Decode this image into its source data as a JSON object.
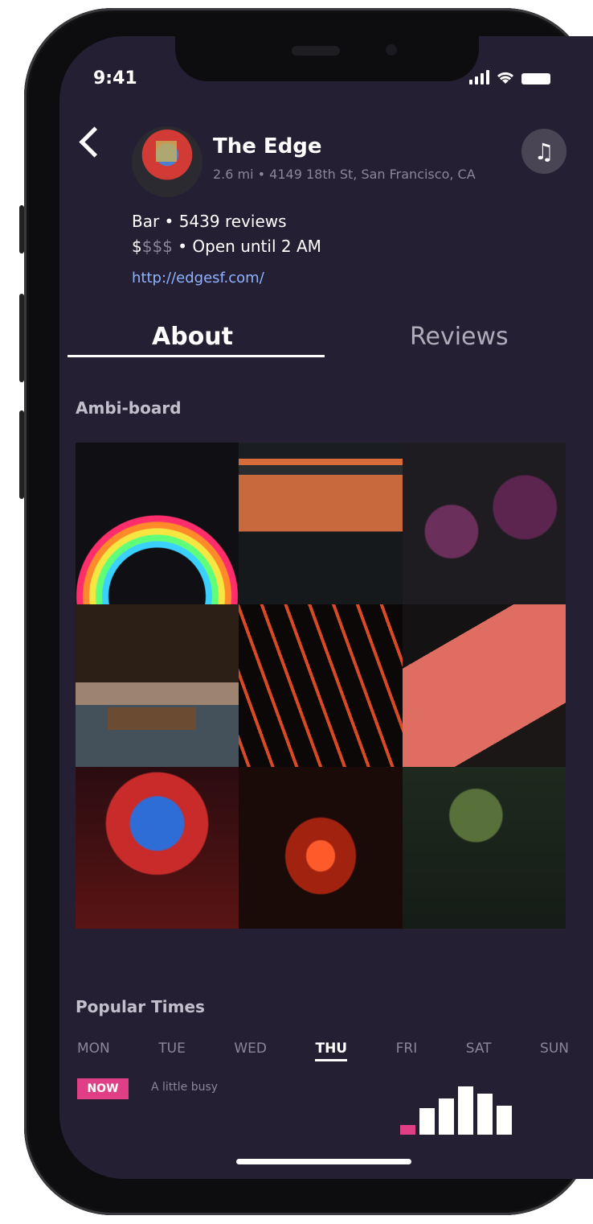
{
  "status_bar": {
    "time": "9:41"
  },
  "header": {
    "venue_name": "The Edge",
    "address_line": "2.6 mi • 4149 18th St, San Francisco, CA",
    "category_reviews": "Bar • 5439 reviews",
    "price_active": "$",
    "price_inactive": "$$$",
    "hours": " • Open until 2 AM",
    "website": "http://edgesf.com/"
  },
  "tabs": [
    {
      "label": "About"
    },
    {
      "label": "Reviews"
    }
  ],
  "sections": {
    "ambi_board": "Ambi-board",
    "popular_times": "Popular Times"
  },
  "popular_times": {
    "days": [
      "MON",
      "TUE",
      "WED",
      "THU",
      "FRI",
      "SAT",
      "SUN"
    ],
    "selected_day": "THU",
    "now_label": "NOW",
    "busy_status": "A little busy",
    "hourly_levels": [
      0.2,
      0.55,
      0.75,
      1.0,
      0.85,
      0.6
    ]
  },
  "icons": {
    "back": "chevron-left-icon",
    "music": "music-note-icon"
  },
  "colors": {
    "background": "#251f33",
    "accent": "#e03f86",
    "link": "#8fb3ff"
  }
}
